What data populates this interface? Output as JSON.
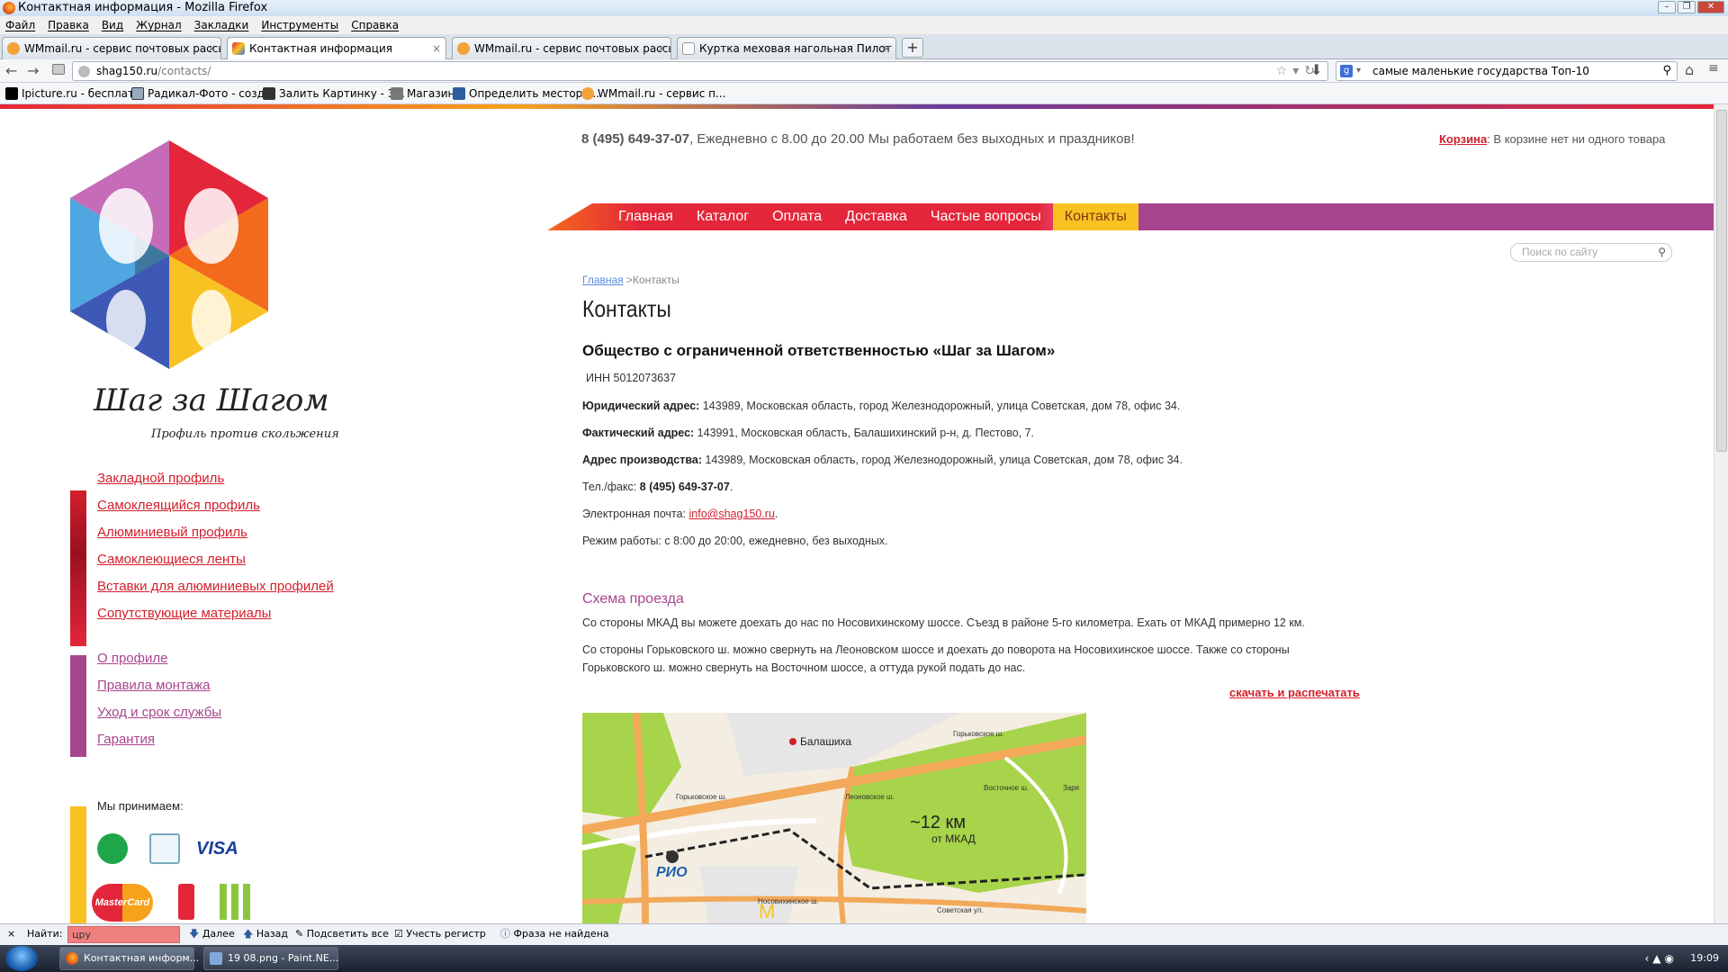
{
  "window": {
    "title": "Контактная информация - Mozilla Firefox"
  },
  "menubar": [
    "Файл",
    "Правка",
    "Вид",
    "Журнал",
    "Закладки",
    "Инструменты",
    "Справка"
  ],
  "tabs": [
    {
      "label": "WMmail.ru - сервис почтовых рассылок...",
      "close": "×"
    },
    {
      "label": "Контактная информация",
      "close": "×"
    },
    {
      "label": "WMmail.ru - сервис почтовых рассылок...",
      "close": "×"
    },
    {
      "label": "Куртка меховая нагольная Пилот из о...",
      "close": "×"
    }
  ],
  "newtab": "+",
  "nav": {
    "back": "←",
    "forward": "→",
    "url_host": "shag150.ru",
    "url_path": "/contacts/",
    "search_text": "самые маленькие государства Топ-10",
    "search_engine": "g"
  },
  "bookmarks": [
    "Ipicture.ru - бесплат...",
    "Радикал-Фото - созд...",
    "Залить Картинку - З...",
    "Магазин",
    "Определить местора...",
    "WMmail.ru - сервис п..."
  ],
  "site": {
    "phone": "8 (495) 649-37-07",
    "hours_text": ", Ежедневно с 8.00 до 20.00 Мы работаем без выходных и праздников!",
    "cart_label": "Корзина",
    "cart_text": ": В корзине нет ни одного товара",
    "logo_title": "Шаг за Шагом",
    "logo_slogan": "Профиль против скольжения",
    "main_nav": [
      "Главная",
      "Каталог",
      "Оплата",
      "Доставка",
      "Частые вопросы",
      "Контакты"
    ],
    "search_placeholder": "Поиск по сайту",
    "left_menu_1": [
      "Закладной профиль",
      "Самоклеящийся профиль",
      "Алюминиевый профиль",
      "Самоклеющиеся ленты",
      "Вставки для алюминиевых профилей",
      "Сопутствующие материалы"
    ],
    "left_menu_2": [
      "О профиле",
      "Правила монтажа",
      "Уход и срок службы",
      "Гарантия"
    ],
    "accept_label": "Мы принимаем:",
    "payment_visa": "VISA",
    "payment_mastercard": "MasterCard"
  },
  "content": {
    "crumb_home": "Главная",
    "crumb_sep": " >",
    "crumb_current": "Контакты",
    "title": "Контакты",
    "company": "Общество с ограниченной ответственностью «Шаг за Шагом»",
    "inn": "ИНН  5012073637",
    "legal_label": "Юридический адрес:",
    "legal": " 143989, Московская область, город Железнодорожный, улица Советская, дом 78, офис 34.",
    "actual_label": "Фактический адрес:",
    "actual": " 143991, Московская область, Балашихинский р-н, д. Пестово, 7.",
    "prod_label": "Адрес производства:",
    "prod": " 143989, Московская область, город Железнодорожный, улица Советская, дом 78, офис 34.",
    "tel_label": "Тел./факс: ",
    "tel": "8 (495) 649-37-07",
    "tel_end": ".",
    "email_label": "Электронная почта: ",
    "email": "info@shag150.ru",
    "email_end": ".",
    "hours": "Режим работы: с 8:00 до 20:00, ежедневно, без выходных.",
    "route_title": "Схема проезда",
    "route1": "Со стороны МКАД вы можете доехать до нас по Носовихинскому шоссе. Съезд в районе 5-го километра. Ехать от МКАД примерно 12 км.",
    "route2a": "Со стороны Горьковского ш. можно свернуть на Леоновском шоссе и доехать до поворота на Носовихинское шоссе. Также со стороны",
    "route2b": "Горьковского ш. можно свернуть на Восточном шоссе, а оттуда рукой подать до нас.",
    "print_link": "скачать и распечатать",
    "map": {
      "balashikha": "Балашиха",
      "gorkovskoe1": "Горьковское ш.",
      "gorkovskoe2": "Горьковское ш.",
      "leonovskoe": "Леоновское ш.",
      "vostochnoe": "Восточное ш.",
      "zarya": "Заря",
      "km": "~12 км",
      "from": "от МКАД",
      "rio": "РИО",
      "nosovikhinskoe": "Носовихинское ш.",
      "sovetskaya": "Советская ул."
    }
  },
  "findbar": {
    "label": "Найти:",
    "value": "цру",
    "next": "Далее",
    "prev": "Назад",
    "highlight": "Подсветить все",
    "case": "Учесть регистр",
    "status": "Фраза не найдена",
    "close": "×"
  },
  "taskbar": {
    "task1": "Контактная информ...",
    "task2": "19 08.png - Paint.NE...",
    "clock": "19:09"
  }
}
